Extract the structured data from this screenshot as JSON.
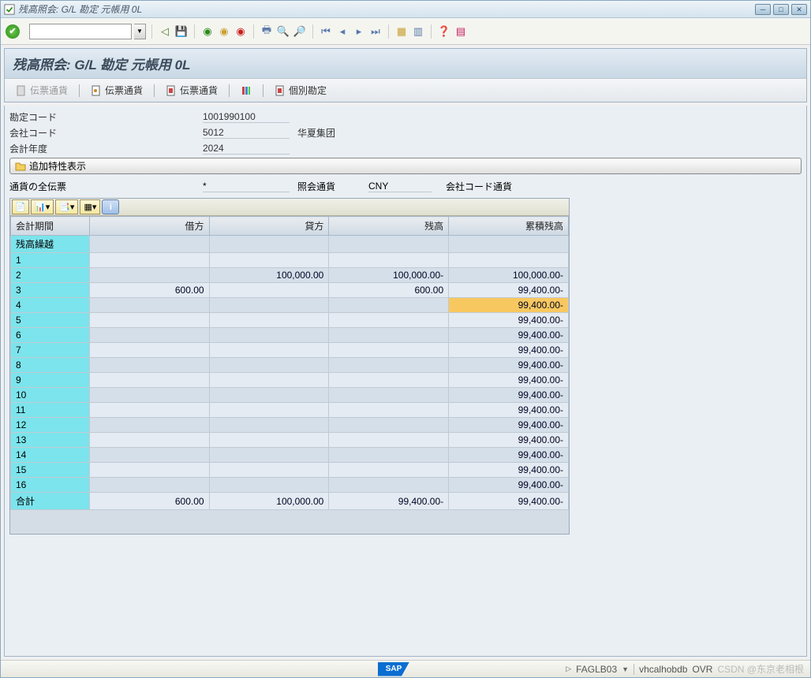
{
  "window": {
    "title": "残高照会: G/L 勘定 元帳用 0L"
  },
  "subheader": {
    "title": "残高照会: G/L 勘定 元帳用 0L"
  },
  "buttons": {
    "doc1": "伝票通貨",
    "doc2": "伝票通貨",
    "doc3": "伝票通貨",
    "doc4": "個別勘定"
  },
  "fields": {
    "account_label": "勘定コード",
    "account_value": "1001990100",
    "company_label": "会社コード",
    "company_value": "5012",
    "company_desc": "华夏集团",
    "fy_label": "会計年度",
    "fy_value": "2024",
    "show_char": "追加特性表示",
    "all_docs_label": "通貨の全伝票",
    "all_docs_value": "*",
    "inq_curr_label": "照会通貨",
    "inq_curr_value": "CNY",
    "cc_curr_label": "会社コード通貨"
  },
  "grid": {
    "headers": {
      "period": "会計期間",
      "debit": "借方",
      "credit": "貸方",
      "balance": "残高",
      "cum": "累積残高"
    },
    "rows": [
      {
        "period": "残高繰越",
        "debit": "",
        "credit": "",
        "balance": "",
        "cum": ""
      },
      {
        "period": "1",
        "debit": "",
        "credit": "",
        "balance": "",
        "cum": ""
      },
      {
        "period": "2",
        "debit": "",
        "credit": "100,000.00",
        "balance": "100,000.00-",
        "cum": "100,000.00-"
      },
      {
        "period": "3",
        "debit": "600.00",
        "credit": "",
        "balance": "600.00",
        "cum": "99,400.00-"
      },
      {
        "period": "4",
        "debit": "",
        "credit": "",
        "balance": "",
        "cum": "99,400.00-",
        "hl": true
      },
      {
        "period": "5",
        "debit": "",
        "credit": "",
        "balance": "",
        "cum": "99,400.00-"
      },
      {
        "period": "6",
        "debit": "",
        "credit": "",
        "balance": "",
        "cum": "99,400.00-"
      },
      {
        "period": "7",
        "debit": "",
        "credit": "",
        "balance": "",
        "cum": "99,400.00-"
      },
      {
        "period": "8",
        "debit": "",
        "credit": "",
        "balance": "",
        "cum": "99,400.00-"
      },
      {
        "period": "9",
        "debit": "",
        "credit": "",
        "balance": "",
        "cum": "99,400.00-"
      },
      {
        "period": "10",
        "debit": "",
        "credit": "",
        "balance": "",
        "cum": "99,400.00-"
      },
      {
        "period": "11",
        "debit": "",
        "credit": "",
        "balance": "",
        "cum": "99,400.00-"
      },
      {
        "period": "12",
        "debit": "",
        "credit": "",
        "balance": "",
        "cum": "99,400.00-"
      },
      {
        "period": "13",
        "debit": "",
        "credit": "",
        "balance": "",
        "cum": "99,400.00-"
      },
      {
        "period": "14",
        "debit": "",
        "credit": "",
        "balance": "",
        "cum": "99,400.00-"
      },
      {
        "period": "15",
        "debit": "",
        "credit": "",
        "balance": "",
        "cum": "99,400.00-"
      },
      {
        "period": "16",
        "debit": "",
        "credit": "",
        "balance": "",
        "cum": "99,400.00-"
      },
      {
        "period": "合計",
        "debit": "600.00",
        "credit": "100,000.00",
        "balance": "99,400.00-",
        "cum": "99,400.00-"
      }
    ]
  },
  "status": {
    "sap": "SAP",
    "tcode": "FAGLB03",
    "host": "vhcalhobdb",
    "ovr": "OVR",
    "watermark": "CSDN @东京老相根"
  }
}
